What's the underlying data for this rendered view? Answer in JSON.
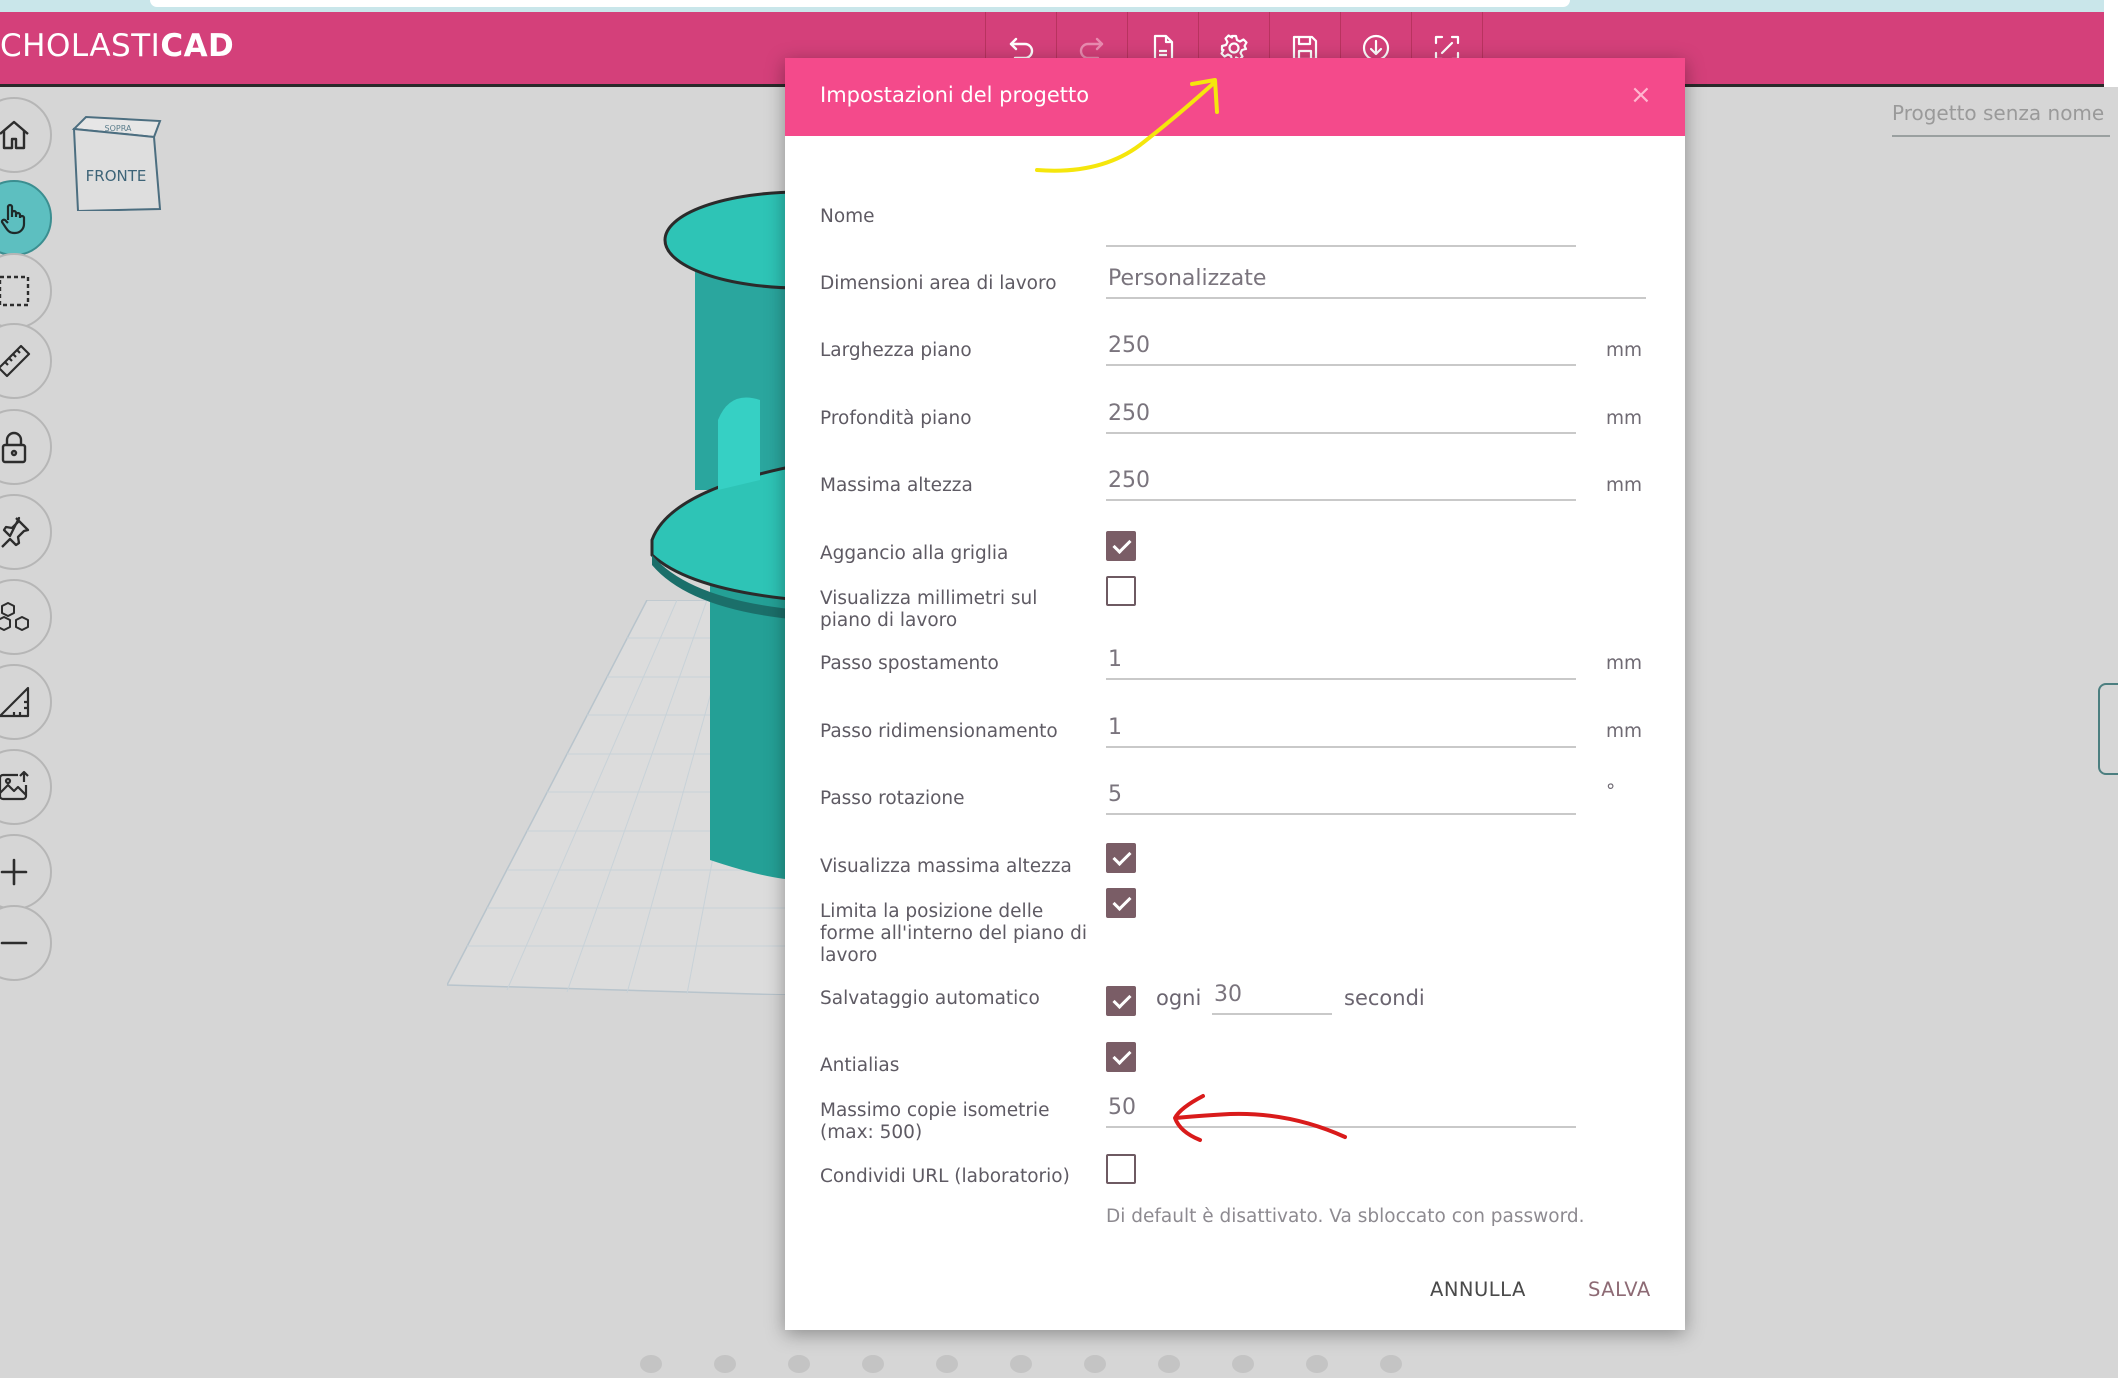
{
  "app": {
    "logo_light": "CHOLASTI",
    "logo_bold": "CAD",
    "project_name": "Progetto senza nome"
  },
  "toolbar": {
    "buttons": [
      {
        "icon": "undo-icon"
      },
      {
        "icon": "redo-icon"
      },
      {
        "icon": "new-file-icon"
      },
      {
        "icon": "gear-icon"
      },
      {
        "icon": "save-icon"
      },
      {
        "icon": "download-icon"
      },
      {
        "icon": "fullscreen-icon"
      }
    ]
  },
  "sidebar": {
    "items": [
      {
        "icon": "home-icon"
      },
      {
        "icon": "hand-icon",
        "active": true
      },
      {
        "icon": "select-box-icon"
      },
      {
        "icon": "ruler-icon"
      },
      {
        "icon": "lock-icon"
      },
      {
        "icon": "pin-icon"
      },
      {
        "icon": "cubes-icon"
      },
      {
        "icon": "set-square-icon"
      },
      {
        "icon": "image-upload-icon"
      },
      {
        "icon": "zoom-in-icon"
      },
      {
        "icon": "zoom-out-icon"
      }
    ]
  },
  "viewcube": {
    "top_label": "SOPRA",
    "front_label": "FRONTE"
  },
  "dialog": {
    "title": "Impostazioni del progetto",
    "close": "×",
    "fields": {
      "nome": {
        "label": "Nome",
        "value": ""
      },
      "dimensioni": {
        "label": "Dimensioni area di lavoro",
        "value": "Personalizzate"
      },
      "larghezza": {
        "label": "Larghezza piano",
        "value": "250",
        "unit": "mm"
      },
      "profondita": {
        "label": "Profondità piano",
        "value": "250",
        "unit": "mm"
      },
      "altezza": {
        "label": "Massima altezza",
        "value": "250",
        "unit": "mm"
      },
      "aggancio": {
        "label": "Aggancio alla griglia",
        "checked": true
      },
      "millimetri": {
        "label": "Visualizza millimetri sul piano di lavoro",
        "checked": false
      },
      "spostamento": {
        "label": "Passo spostamento",
        "value": "1",
        "unit": "mm"
      },
      "ridimensionamento": {
        "label": "Passo ridimensionamento",
        "value": "1",
        "unit": "mm"
      },
      "rotazione": {
        "label": "Passo rotazione",
        "value": "5",
        "unit": "°"
      },
      "vis_altezza": {
        "label": "Visualizza massima altezza",
        "checked": true
      },
      "limita": {
        "label": "Limita la posizione delle forme all'interno del piano di lavoro",
        "checked": true
      },
      "salvataggio": {
        "label": "Salvataggio automatico",
        "checked": true,
        "prefix": "ogni",
        "value": "30",
        "suffix": "secondi"
      },
      "antialias": {
        "label": "Antialias",
        "checked": true
      },
      "copie": {
        "label": "Massimo copie isometrie (max: 500)",
        "value": "50"
      },
      "condividi": {
        "label": "Condividi URL (laboratorio)",
        "checked": false,
        "hint": "Di default è disattivato. Va sbloccato con password."
      }
    },
    "cancel_label": "ANNULLA",
    "save_label": "SALVA"
  },
  "colors": {
    "header": "#d4407a",
    "dialog_header": "#f44a8b",
    "checkbox": "#7a5d66",
    "object": "#2fc0b6",
    "annotation_yellow": "#f5e60c",
    "annotation_red": "#d91b1b"
  }
}
